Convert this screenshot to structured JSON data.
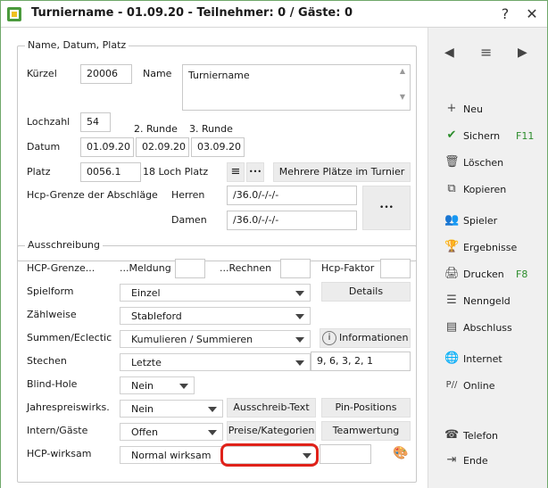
{
  "window": {
    "title": "Turniername - 01.09.20 - Teilnehmer: 0 / Gäste: 0",
    "help_glyph": "?",
    "close_glyph": "✕"
  },
  "group1": {
    "legend": "Name, Datum, Platz",
    "kuerzel_label": "Kürzel",
    "kuerzel_value": "20006",
    "name_label": "Name",
    "name_value": "Turniername",
    "lochzahl_label": "Lochzahl",
    "lochzahl_value": "54",
    "runde2_label": "2. Runde",
    "runde3_label": "3. Runde",
    "datum_label": "Datum",
    "datum1": "01.09.20",
    "datum2": "02.09.20",
    "datum3": "03.09.20",
    "platz_label": "Platz",
    "platz_value": "0056.1",
    "platz_desc": "18 Loch Platz",
    "mehrere_plaetze": "Mehrere Plätze im Turnier",
    "hcp_grenze_label": "Hcp-Grenze der Abschläge",
    "herren_label": "Herren",
    "herren_value": "/36.0/-/-/-",
    "damen_label": "Damen",
    "damen_value": "/36.0/-/-/-",
    "more_glyph": "•••"
  },
  "group2": {
    "legend": "Ausschreibung",
    "hcp_grenze_label": "HCP-Grenze...",
    "meldung_label": "...Meldung",
    "rechnen_label": "...Rechnen",
    "hcp_faktor_label": "Hcp-Faktor",
    "spielform_label": "Spielform",
    "spielform_value": "Einzel",
    "details_button": "Details",
    "zaehlweise_label": "Zählweise",
    "zaehlweise_value": "Stableford",
    "summen_label": "Summen/Eclectic",
    "summen_value": "Kumulieren / Summieren",
    "informationen_button": "Informationen",
    "stechen_label": "Stechen",
    "stechen_value": "Letzte",
    "stechen_holes": "9, 6, 3, 2, 1",
    "blind_hole_label": "Blind-Hole",
    "blind_hole_value": "Nein",
    "jahrespreis_label": "Jahrespreiswirks.",
    "jahrespreis_value": "Nein",
    "ausschreib_text_button": "Ausschreib-Text",
    "pin_positions_button": "Pin-Positions",
    "intern_gaeste_label": "Intern/Gäste",
    "intern_gaeste_value": "Offen",
    "preise_button": "Preise/Kategorien",
    "teamwertung_button": "Teamwertung",
    "hcp_wirksam_label": "HCP-wirksam",
    "hcp_wirksam_value": "Normal wirksam"
  },
  "sidebar": {
    "items": [
      {
        "label": "Neu",
        "icon": "plus-icon",
        "shortcut": ""
      },
      {
        "label": "Sichern",
        "icon": "check-icon",
        "shortcut": "F11"
      },
      {
        "label": "Löschen",
        "icon": "trash-icon",
        "shortcut": ""
      },
      {
        "label": "Kopieren",
        "icon": "copy-icon",
        "shortcut": ""
      },
      {
        "label": "Spieler",
        "icon": "user-icon",
        "shortcut": ""
      },
      {
        "label": "Ergebnisse",
        "icon": "trophy-icon",
        "shortcut": ""
      },
      {
        "label": "Drucken",
        "icon": "printer-icon",
        "shortcut": "F8"
      },
      {
        "label": "Nenngeld",
        "icon": "coins-icon",
        "shortcut": ""
      },
      {
        "label": "Abschluss",
        "icon": "stack-icon",
        "shortcut": ""
      },
      {
        "label": "Internet",
        "icon": "globe-icon",
        "shortcut": ""
      },
      {
        "label": "Online",
        "icon": "online-icon",
        "shortcut": ""
      },
      {
        "label": "Telefon",
        "icon": "phone-icon",
        "shortcut": ""
      },
      {
        "label": "Ende",
        "icon": "exit-icon",
        "shortcut": ""
      }
    ]
  },
  "colors": {
    "accent_green": "#2a8c2a",
    "highlight_red": "#e0221a"
  }
}
